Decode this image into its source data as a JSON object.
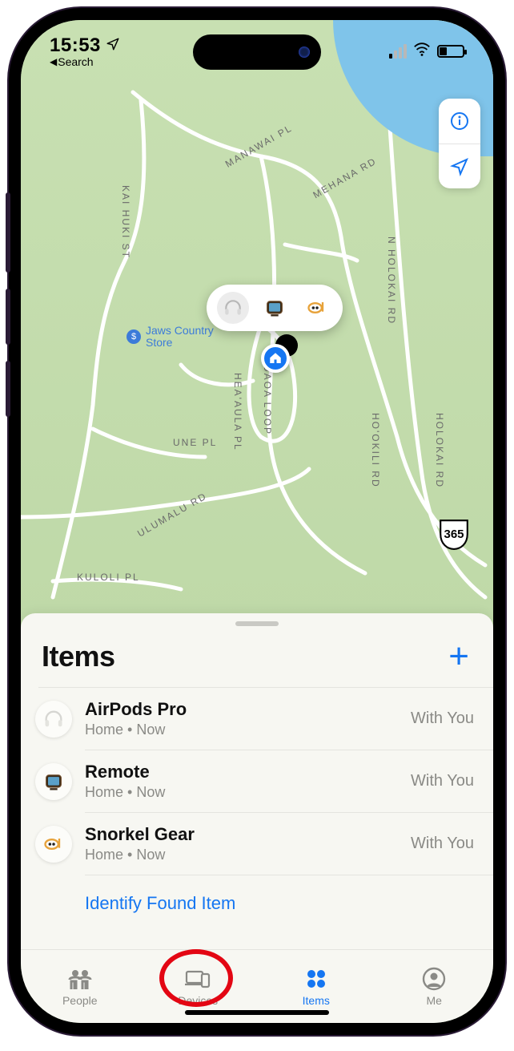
{
  "status": {
    "time": "15:53",
    "back_label": "Search"
  },
  "map": {
    "poi_label": "Jaws Country\nStore",
    "route_number": "365",
    "roads": {
      "kai_huki": "KAI HUKI ST",
      "manawai": "MANAWAI PL",
      "mehana": "MEHANA RD",
      "n_holokai": "N HOLOKAI RD",
      "hookili": "HO'OKILI RD",
      "holokai": "HOLOKAI RD",
      "uaoa": "UAOA LOOP",
      "heaaula": "HEA'AULA PL",
      "une": "UNE PL",
      "ulumalu": "ULUMALU RD",
      "kuloli": "KULOLI PL"
    }
  },
  "sheet": {
    "title": "Items",
    "identify_label": "Identify Found Item",
    "rows": [
      {
        "icon": "headphones",
        "title": "AirPods Pro",
        "sub": "Home • Now",
        "status": "With You"
      },
      {
        "icon": "tv",
        "title": "Remote",
        "sub": "Home • Now",
        "status": "With You"
      },
      {
        "icon": "snorkel",
        "title": "Snorkel Gear",
        "sub": "Home • Now",
        "status": "With You"
      }
    ]
  },
  "tabs": {
    "people": "People",
    "devices": "Devices",
    "items": "Items",
    "me": "Me"
  }
}
